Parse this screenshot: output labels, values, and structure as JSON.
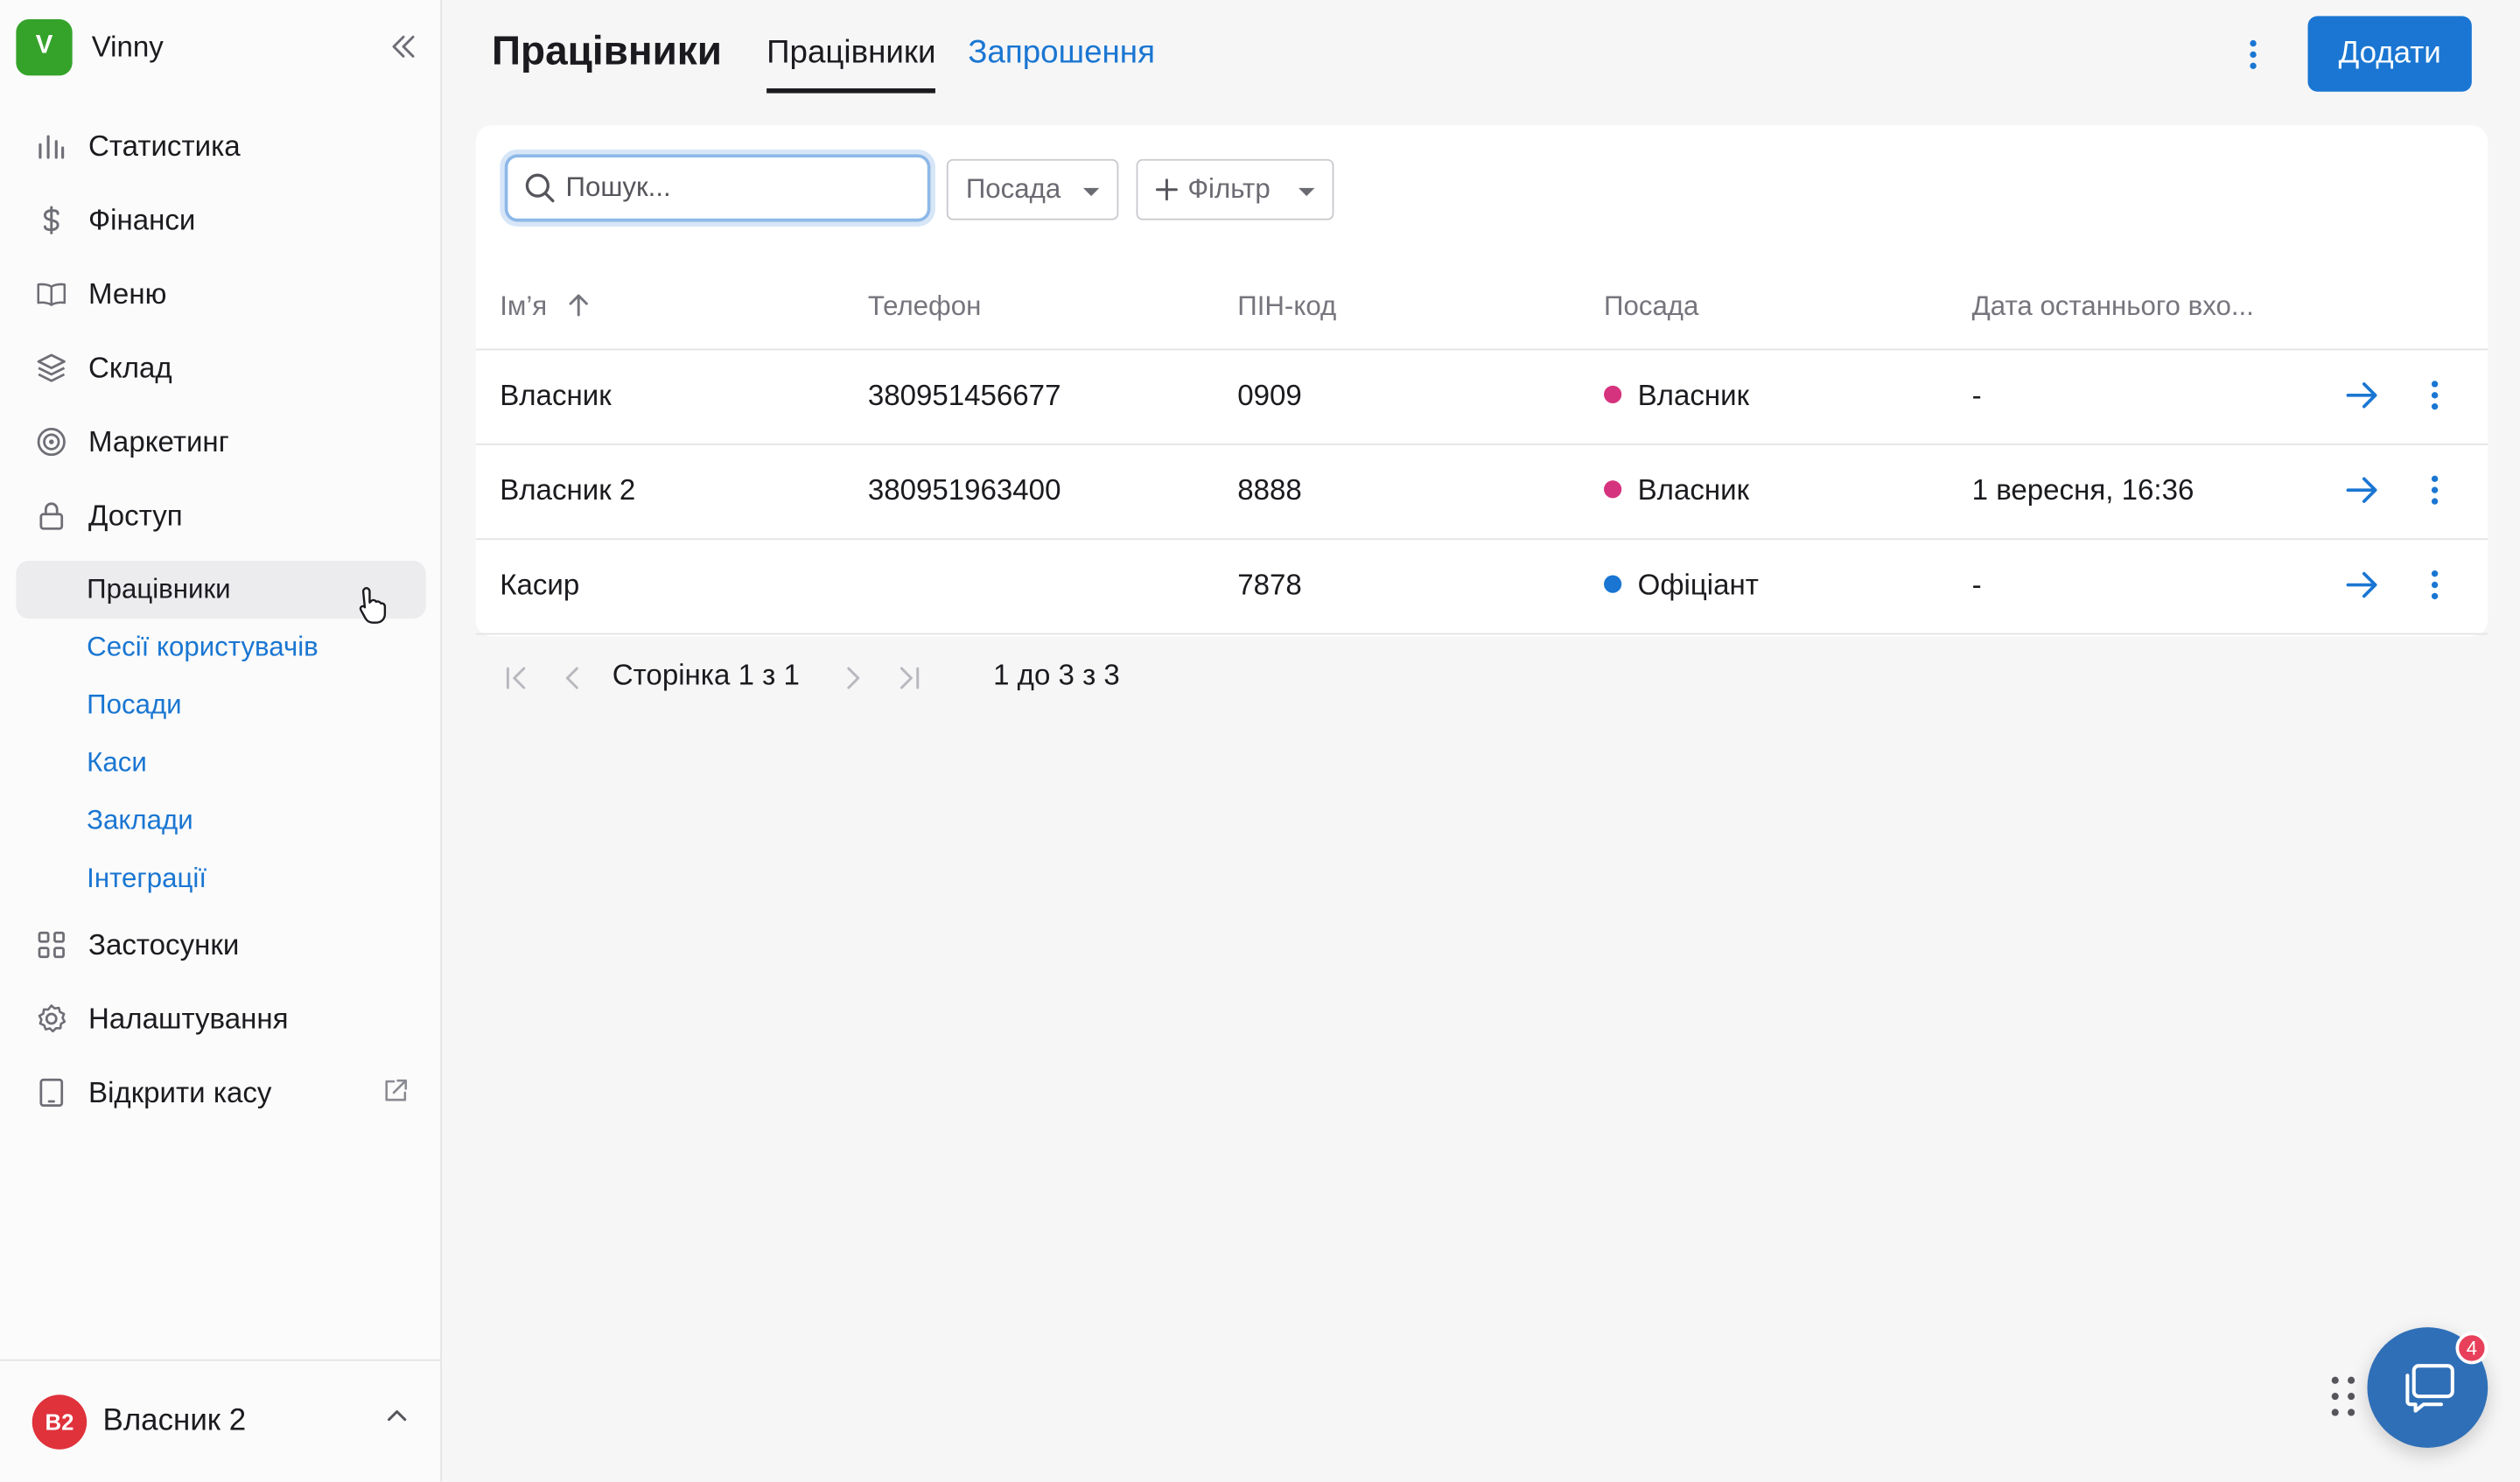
{
  "brand": {
    "logo_letter": "V",
    "name": "Vinny"
  },
  "nav": {
    "items": [
      {
        "label": "Статистика",
        "icon": "bar-chart-icon"
      },
      {
        "label": "Фінанси",
        "icon": "dollar-icon"
      },
      {
        "label": "Меню",
        "icon": "book-icon"
      },
      {
        "label": "Склад",
        "icon": "layers-icon"
      },
      {
        "label": "Маркетинг",
        "icon": "target-icon"
      },
      {
        "label": "Доступ",
        "icon": "lock-icon"
      }
    ],
    "sub_items": [
      "Працівники",
      "Сесії користувачів",
      "Посади",
      "Каси",
      "Заклади",
      "Інтеграції"
    ],
    "bottom_items": [
      {
        "label": "Застосунки",
        "icon": "grid-icon"
      },
      {
        "label": "Налаштування",
        "icon": "gear-icon"
      },
      {
        "label": "Відкрити касу",
        "icon": "tablet-icon"
      }
    ]
  },
  "user": {
    "initials": "В2",
    "name": "Власник 2"
  },
  "header": {
    "title": "Працівники",
    "tabs": [
      "Працівники",
      "Запрошення"
    ],
    "add_label": "Додати"
  },
  "search": {
    "placeholder": "Пошук..."
  },
  "filters": {
    "position_label": "Посада",
    "filter_label": "Фільтр"
  },
  "table": {
    "columns": [
      "Ім’я",
      "Телефон",
      "ПІН-код",
      "Посада",
      "Дата останнього вхо..."
    ],
    "rows": [
      {
        "name": "Власник",
        "phone": "380951456677",
        "pin": "0909",
        "position": "Власник",
        "position_color": "#d6337e",
        "last_login": "-"
      },
      {
        "name": "Власник 2",
        "phone": "380951963400",
        "pin": "8888",
        "position": "Власник",
        "position_color": "#d6337e",
        "last_login": "1 вересня, 16:36"
      },
      {
        "name": "Касир",
        "phone": "",
        "pin": "7878",
        "position": "Офіціант",
        "position_color": "#1a76d2",
        "last_login": "-"
      }
    ]
  },
  "pagination": {
    "page_text": "Сторінка 1 з 1",
    "range_text": "1 до 3 з 3"
  },
  "chat": {
    "badge": "4"
  },
  "colors": {
    "accent": "#1a76d2",
    "brand": "#35a32a"
  }
}
